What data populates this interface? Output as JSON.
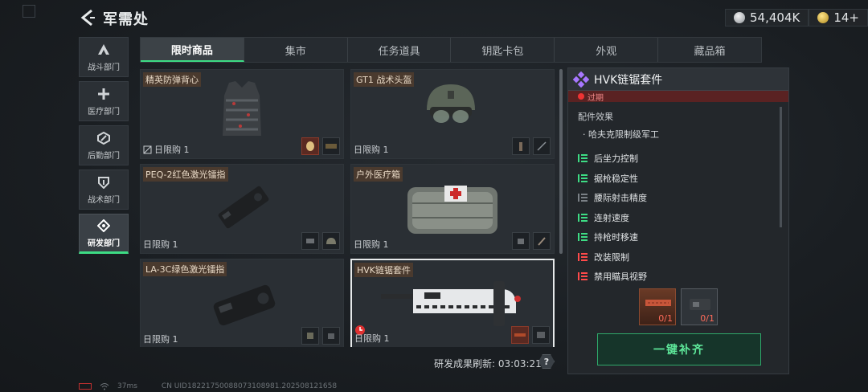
{
  "header": {
    "title": "军需处",
    "currency": [
      {
        "icon": "silver-coin-icon",
        "value": "54,404K"
      },
      {
        "icon": "gold-coin-icon",
        "value": "14+"
      }
    ]
  },
  "sidebar": {
    "items": [
      {
        "label": "战斗部门",
        "icon": "combat-icon",
        "active": false
      },
      {
        "label": "医疗部门",
        "icon": "medical-cross-icon",
        "active": false
      },
      {
        "label": "后勤部门",
        "icon": "logistics-icon",
        "active": false
      },
      {
        "label": "战术部门",
        "icon": "shield-icon",
        "active": false
      },
      {
        "label": "研发部门",
        "icon": "research-icon",
        "active": true
      }
    ]
  },
  "tabs": [
    "限时商品",
    "集市",
    "任务道具",
    "钥匙卡包",
    "外观",
    "藏品箱"
  ],
  "items": [
    {
      "name": "精英防弹背心",
      "limit": "日限购 1"
    },
    {
      "name": "GT1 战术头盔",
      "limit": "日限购 1"
    },
    {
      "name": "PEQ-2红色激光镭指",
      "limit": "日限购 1"
    },
    {
      "name": "户外医疗箱",
      "limit": "日限购 1"
    },
    {
      "name": "LA-3C绿色激光镭指",
      "limit": "日限购 1"
    },
    {
      "name": "HVK链锯套件",
      "limit": "日限购 1"
    }
  ],
  "refresh": {
    "label": "研发成果刷新:",
    "time": "03:03:21",
    "help": "?"
  },
  "detail": {
    "title": "HVK链锯套件",
    "expire": "过期",
    "effects_title": "配件效果",
    "effects_sub": "· 哈夫克限制级军工",
    "attributes": [
      {
        "label": "后坐力控制",
        "color": "#3ddc84"
      },
      {
        "label": "据枪稳定性",
        "color": "#3ddc84"
      },
      {
        "label": "腰际射击精度",
        "color": "#7a8086"
      },
      {
        "label": "连射速度",
        "color": "#3ddc84"
      },
      {
        "label": "持枪时移速",
        "color": "#3ddc84"
      },
      {
        "label": "改装限制",
        "color": "#ff4a4a"
      },
      {
        "label": "禁用瞄具视野",
        "color": "#ff4a4a"
      }
    ],
    "materials": [
      "0/1",
      "0/1"
    ],
    "refill_label": "一键补齐"
  },
  "footer": {
    "ping": "37ms",
    "uid": "CN UID1822175008807310898​1.202508121658"
  }
}
